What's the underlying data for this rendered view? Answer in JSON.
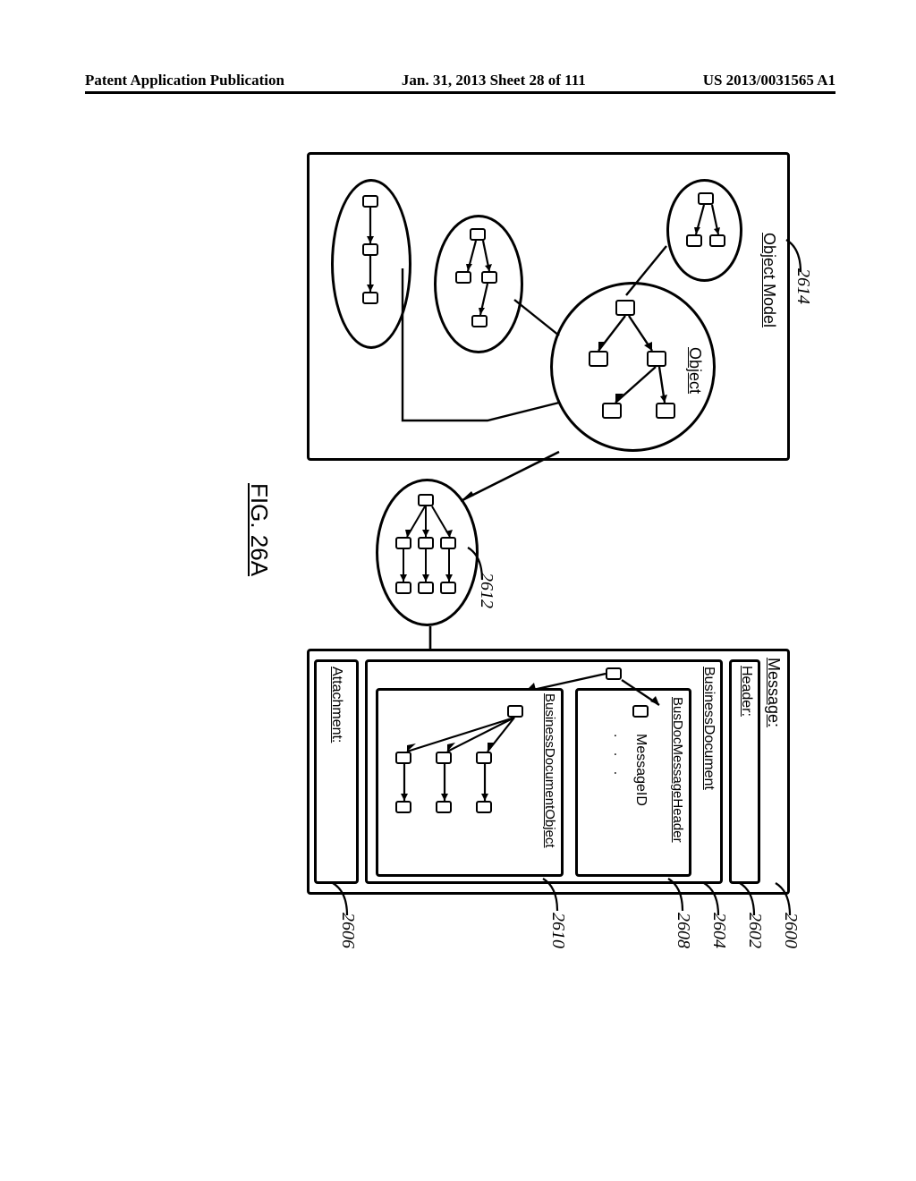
{
  "header": {
    "left": "Patent Application Publication",
    "center": "Jan. 31, 2013  Sheet 28 of 111",
    "right": "US 2013/0031565 A1"
  },
  "fig": {
    "caption": "FIG. 26A",
    "object_model_label": "Object Model",
    "object_label": "Object",
    "ref_2614": "2614",
    "ref_2612": "2612",
    "message_label": "Message:",
    "header_label": "Header:",
    "busdoc_label": "BusinessDocument",
    "busdocmsgheader_label": "BusDocMessageHeader",
    "messageid_label": "MessageID",
    "ellipsis": ".  .  .",
    "busdocobj_label": "BusinessDocumentObject",
    "attachment_label": "Attachment:",
    "ref_2600": "2600",
    "ref_2602": "2602",
    "ref_2604": "2604",
    "ref_2608": "2608",
    "ref_2610": "2610",
    "ref_2606": "2606"
  }
}
